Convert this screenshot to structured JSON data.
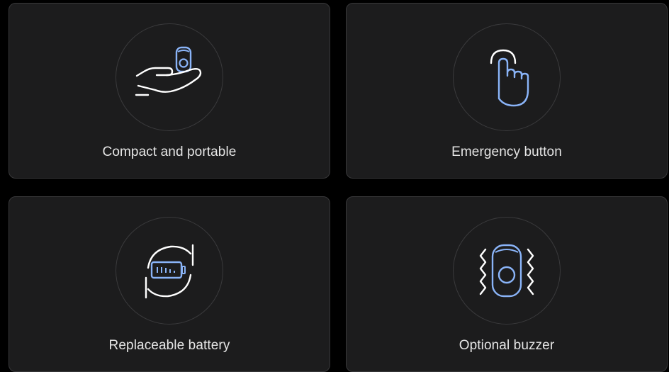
{
  "features": [
    {
      "label": "Compact and portable",
      "icon": "hand-holding-device-icon"
    },
    {
      "label": "Emergency button",
      "icon": "finger-press-icon"
    },
    {
      "label": "Replaceable battery",
      "icon": "battery-swap-icon"
    },
    {
      "label": "Optional buzzer",
      "icon": "vibrating-device-icon"
    }
  ],
  "colors": {
    "background": "#000000",
    "card": "#1c1c1d",
    "card_border": "#38383a",
    "circle_border": "#3a3a3c",
    "line_white": "#ffffff",
    "accent_blue": "#8ab4f8",
    "text": "#e6e6e6"
  }
}
